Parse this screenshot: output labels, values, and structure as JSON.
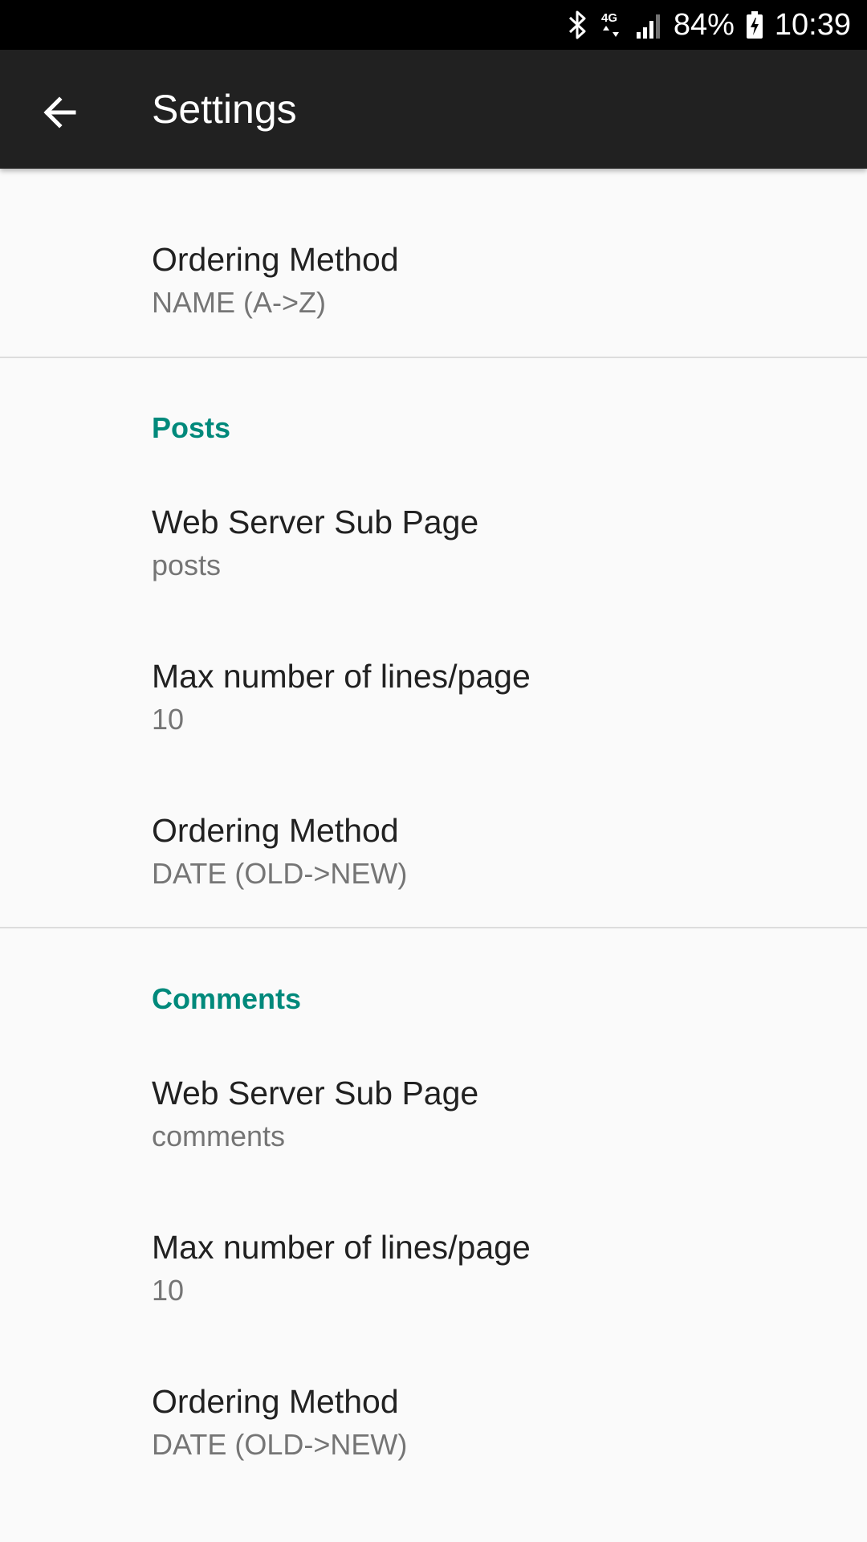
{
  "status_bar": {
    "battery": "84%",
    "time": "10:39",
    "network": "4G",
    "icons": [
      "bluetooth-icon",
      "network-4g-icon",
      "signal-icon",
      "battery-charging-icon"
    ]
  },
  "toolbar": {
    "back_icon": "arrow-back-icon",
    "title": "Settings"
  },
  "general": {
    "ordering": {
      "title": "Ordering Method",
      "summary": "NAME (A->Z)"
    }
  },
  "posts": {
    "header": "Posts",
    "sub_page": {
      "title": "Web Server Sub Page",
      "summary": "posts"
    },
    "max_lines": {
      "title": "Max number of lines/page",
      "summary": "10"
    },
    "ordering": {
      "title": "Ordering Method",
      "summary": "DATE (OLD->NEW)"
    }
  },
  "comments": {
    "header": "Comments",
    "sub_page": {
      "title": "Web Server Sub Page",
      "summary": "comments"
    },
    "max_lines": {
      "title": "Max number of lines/page",
      "summary": "10"
    },
    "ordering": {
      "title": "Ordering Method",
      "summary": "DATE (OLD->NEW)"
    }
  },
  "colors": {
    "accent": "#00897b",
    "toolbar": "#212121",
    "status_bar": "#000000",
    "background": "#fafafa"
  }
}
